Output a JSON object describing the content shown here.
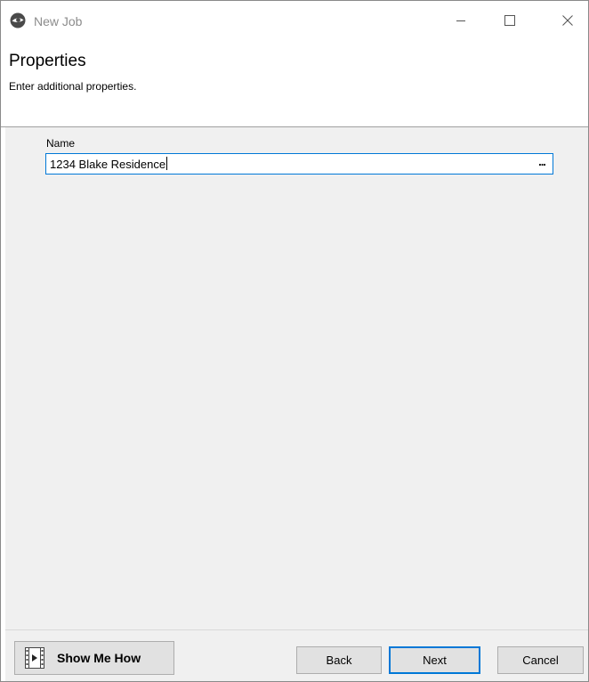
{
  "window": {
    "title": "New Job",
    "icon": "eye-icon",
    "controls": [
      "minimize-icon",
      "maximize-icon",
      "close-icon"
    ]
  },
  "banner": {
    "title": "Properties",
    "subtitle": "Enter additional properties."
  },
  "form": {
    "name_label": "Name",
    "name_value": "1234 Blake Residence",
    "browse_label": "..."
  },
  "footer": {
    "show_me_how_label": "Show Me How",
    "show_me_how_icon": "film-play-icon",
    "back_label": "Back",
    "next_label": "Next",
    "cancel_label": "Cancel"
  },
  "colors": {
    "focus_accent": "#0078d7",
    "panel_bg": "#f0f0f0",
    "button_bg": "#e1e1e1"
  }
}
